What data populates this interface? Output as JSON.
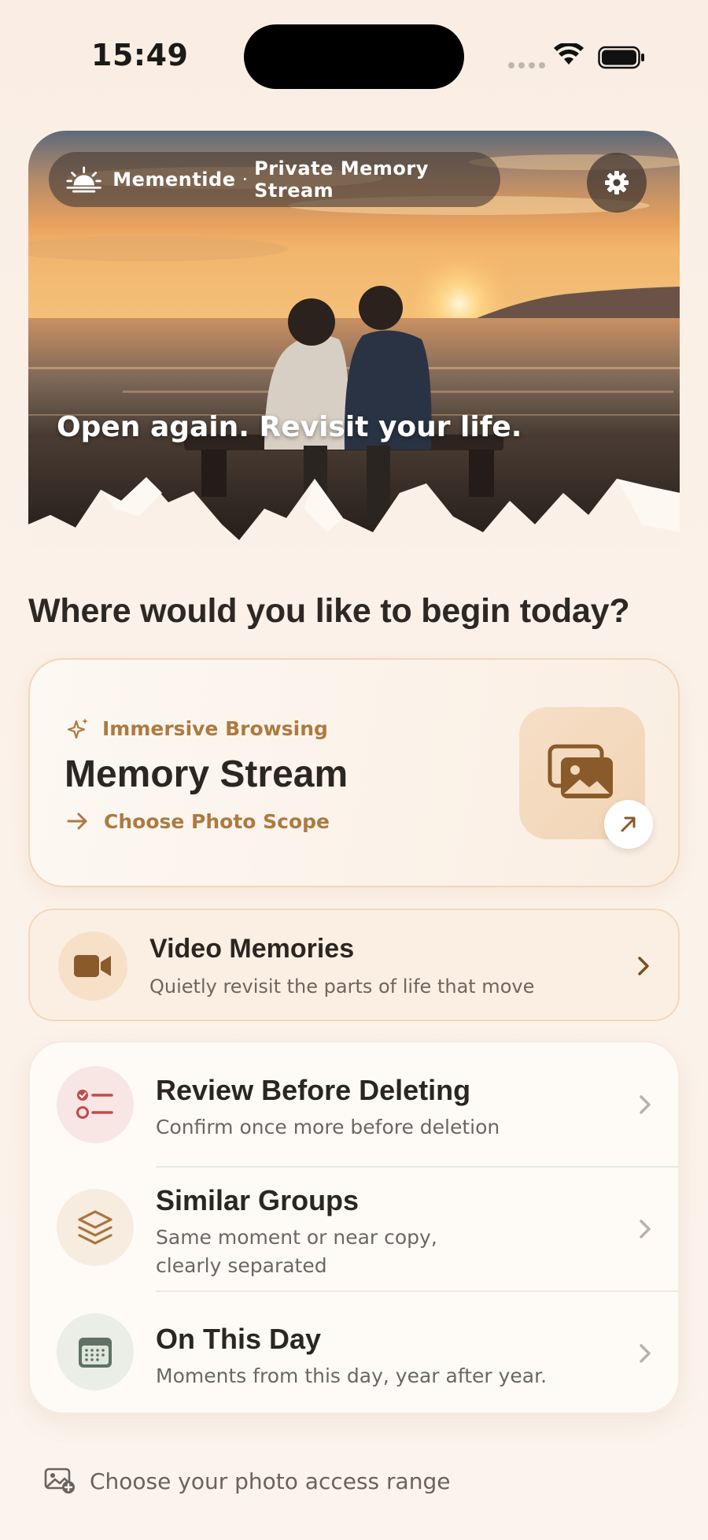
{
  "status_bar": {
    "time": "15:49",
    "wifi_icon": "wifi-icon",
    "battery_icon": "battery-icon"
  },
  "hero": {
    "brand": "Mementide",
    "separator": "·",
    "tagline": "Private Memory Stream",
    "caption": "Open again. Revisit your life.",
    "sun_icon": "sunrise-icon",
    "settings_icon": "gear-icon"
  },
  "heading": "Where would you like to begin today?",
  "memory_stream": {
    "eyebrow": "Immersive Browsing",
    "title": "Memory Stream",
    "action": "Choose Photo Scope",
    "tile_icon": "photos-icon",
    "open_icon": "arrow-up-right-icon"
  },
  "video_memories": {
    "title": "Video Memories",
    "subtitle": "Quietly revisit the parts of life that move",
    "icon": "video-camera-icon"
  },
  "list": [
    {
      "title": "Review Before Deleting",
      "subtitle": "Confirm once more before deletion",
      "icon": "checklist-icon",
      "icon_bg": "#f8e6e4",
      "icon_color": "#c44a4a"
    },
    {
      "title": "Similar Groups",
      "subtitle_line1": "Same moment or near copy,",
      "subtitle_line2": "clearly separated",
      "icon": "layers-icon",
      "icon_bg": "#f6ece0",
      "icon_color": "#a8743a"
    },
    {
      "title": "On This Day",
      "subtitle": "Moments from this day, year after year.",
      "icon": "calendar-icon",
      "icon_bg": "#eaeee6",
      "icon_color": "#5f7263"
    }
  ],
  "footer": {
    "label": "Choose your photo access range",
    "icon": "photo-add-icon"
  },
  "colors": {
    "accent": "#ad7a40",
    "text_primary": "#2c2622",
    "text_secondary": "#6f655e",
    "background": "#fbf1e8"
  }
}
